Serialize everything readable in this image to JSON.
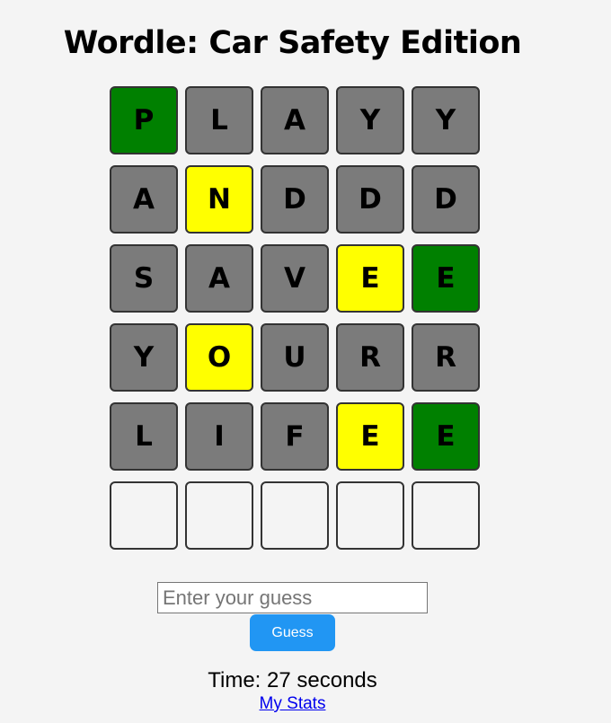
{
  "title": "Wordle: Car Safety Edition",
  "board": [
    [
      {
        "letter": "P",
        "state": "green"
      },
      {
        "letter": "L",
        "state": "gray"
      },
      {
        "letter": "A",
        "state": "gray"
      },
      {
        "letter": "Y",
        "state": "gray"
      },
      {
        "letter": "Y",
        "state": "gray"
      }
    ],
    [
      {
        "letter": "A",
        "state": "gray"
      },
      {
        "letter": "N",
        "state": "yellow"
      },
      {
        "letter": "D",
        "state": "gray"
      },
      {
        "letter": "D",
        "state": "gray"
      },
      {
        "letter": "D",
        "state": "gray"
      }
    ],
    [
      {
        "letter": "S",
        "state": "gray"
      },
      {
        "letter": "A",
        "state": "gray"
      },
      {
        "letter": "V",
        "state": "gray"
      },
      {
        "letter": "E",
        "state": "yellow"
      },
      {
        "letter": "E",
        "state": "green"
      }
    ],
    [
      {
        "letter": "Y",
        "state": "gray"
      },
      {
        "letter": "O",
        "state": "yellow"
      },
      {
        "letter": "U",
        "state": "gray"
      },
      {
        "letter": "R",
        "state": "gray"
      },
      {
        "letter": "R",
        "state": "gray"
      }
    ],
    [
      {
        "letter": "L",
        "state": "gray"
      },
      {
        "letter": "I",
        "state": "gray"
      },
      {
        "letter": "F",
        "state": "gray"
      },
      {
        "letter": "E",
        "state": "yellow"
      },
      {
        "letter": "E",
        "state": "green"
      }
    ],
    [
      {
        "letter": "",
        "state": "empty"
      },
      {
        "letter": "",
        "state": "empty"
      },
      {
        "letter": "",
        "state": "empty"
      },
      {
        "letter": "",
        "state": "empty"
      },
      {
        "letter": "",
        "state": "empty"
      }
    ]
  ],
  "colors": {
    "green": "#008000",
    "yellow": "#ffff00",
    "gray": "#7b7b7b",
    "button": "#2196f3",
    "background": "#f4f4f4"
  },
  "guess_input": {
    "value": "",
    "placeholder": "Enter your guess"
  },
  "guess_button_label": "Guess",
  "timer_text": "Time: 27 seconds",
  "stats_link_label": "My Stats"
}
